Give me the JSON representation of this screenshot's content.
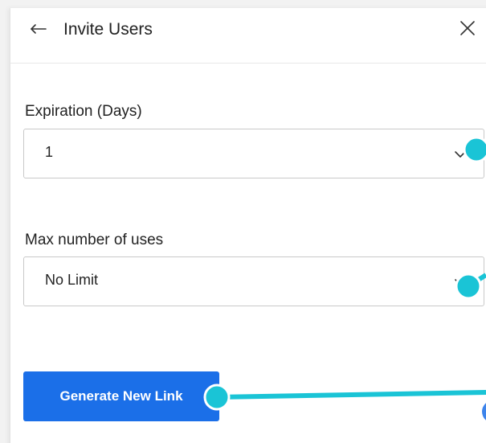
{
  "header": {
    "title": "Invite Users",
    "back_icon": "arrow-left-icon",
    "close_icon": "close-icon"
  },
  "fields": {
    "expiration": {
      "label": "Expiration (Days)",
      "value": "1"
    },
    "max_uses": {
      "label": "Max number of uses",
      "value": "No Limit"
    }
  },
  "actions": {
    "generate_label": "Generate New Link"
  },
  "colors": {
    "primary": "#1b6fe8",
    "annotation": "#1ac4d6"
  }
}
